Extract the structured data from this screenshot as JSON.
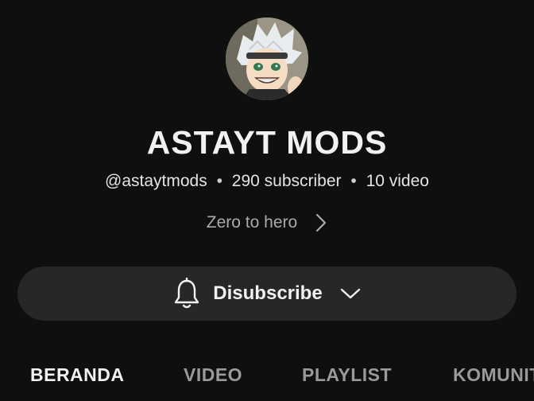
{
  "channel": {
    "name": "ASTAYT MODS",
    "handle": "@astaytmods",
    "separator": "•",
    "subscribers": "290 subscriber",
    "videos": "10 video",
    "tagline": "Zero to hero"
  },
  "subscribe_button": {
    "label": "Disubscribe",
    "bell_icon": "bell-icon",
    "caret_icon": "chevron-down-icon"
  },
  "tabs": [
    {
      "label": "BERANDA",
      "active": true
    },
    {
      "label": "VIDEO",
      "active": false
    },
    {
      "label": "PLAYLIST",
      "active": false
    },
    {
      "label": "KOMUNITAS",
      "active": false
    }
  ],
  "colors": {
    "background": "#0f0f0f",
    "button_bg": "#272727",
    "text_primary": "#f1f1f1",
    "text_secondary": "#aaaaaa"
  }
}
